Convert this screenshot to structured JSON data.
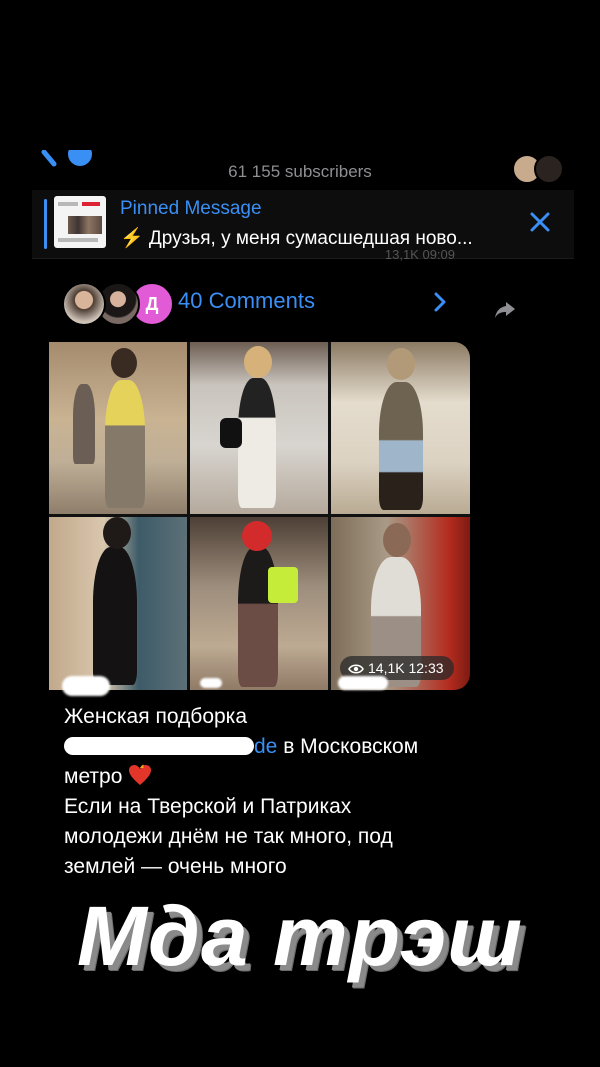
{
  "header": {
    "subscribers": "61 155 subscribers"
  },
  "pinned": {
    "title": "Pinned Message",
    "text": "⚡ Друзья, у меня сумасшедшая ново..."
  },
  "post_meta": "13,1K 09:09",
  "comments": {
    "avatar_letter": "Д",
    "label": "40 Comments"
  },
  "media": {
    "views": "14,1K 12:33"
  },
  "caption": {
    "line1": "Женская подборка",
    "link_tail": "de",
    "line2_rest": " в Московском",
    "line3": "метро",
    "line4": "Если на Тверской и Патриках",
    "line5": "молодежи днём не так много, под",
    "line6": "землей — очень много"
  },
  "overlay": {
    "text": "Мда трэш"
  },
  "colors": {
    "accent": "#3a8ff5",
    "background": "#000000",
    "secondary_text": "#8e8e93"
  }
}
